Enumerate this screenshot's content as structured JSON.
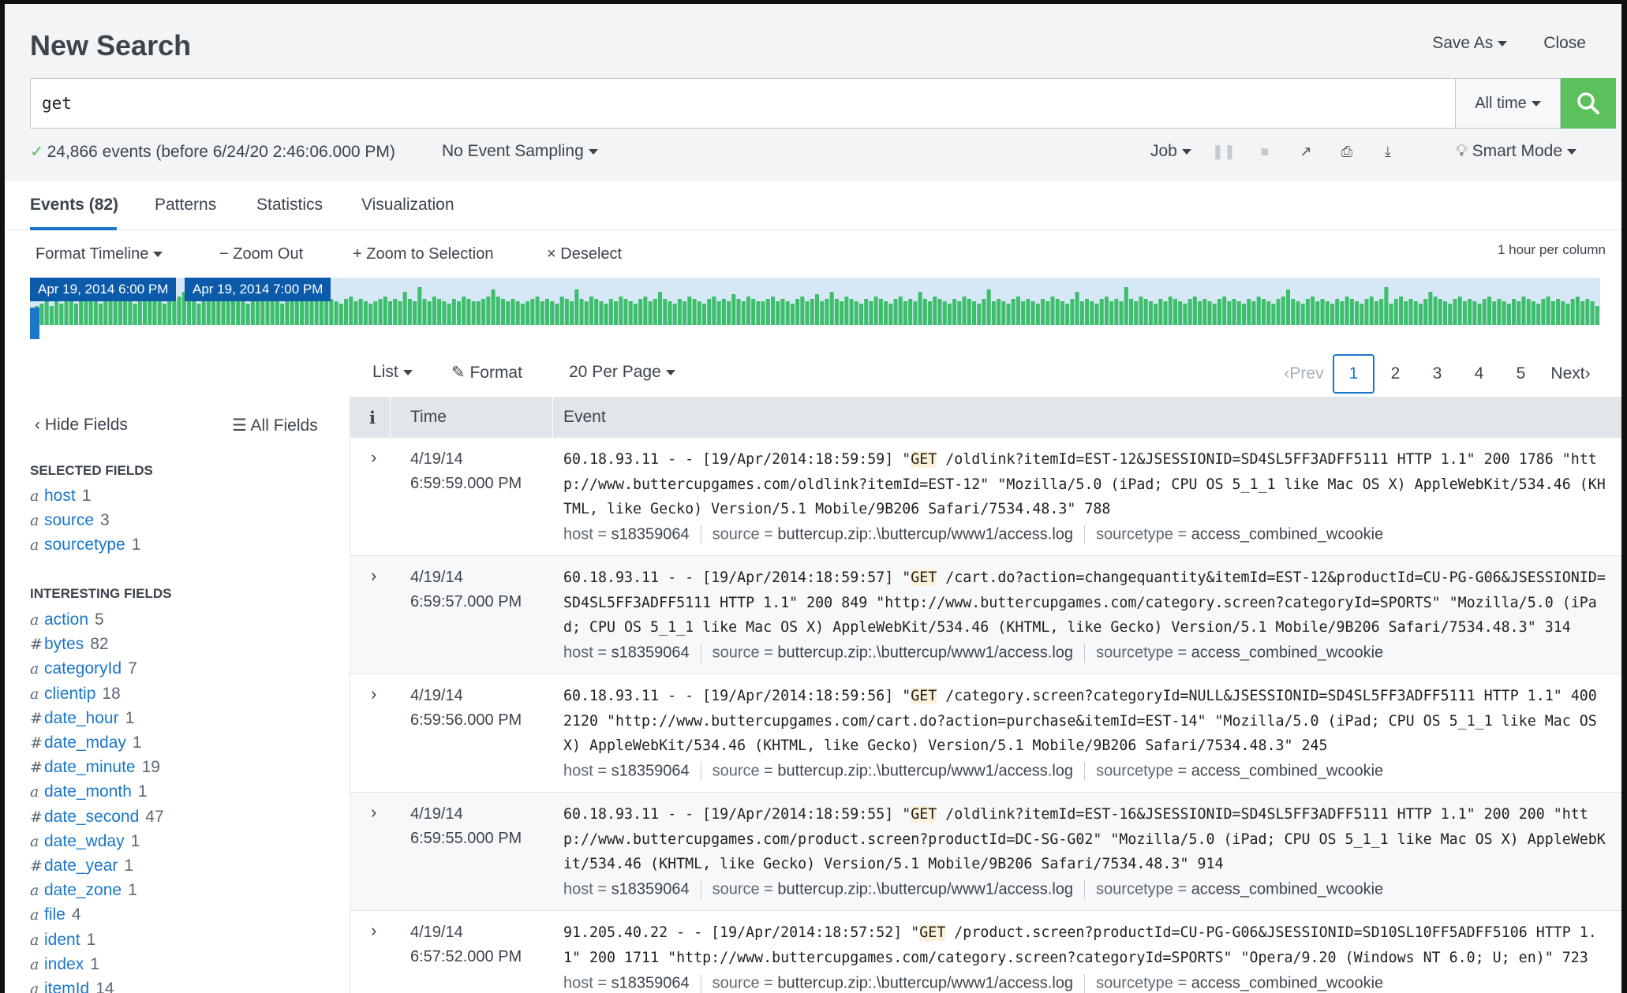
{
  "header": {
    "title": "New Search",
    "save_as": "Save As",
    "close": "Close"
  },
  "search": {
    "query": "get",
    "time_range": "All time"
  },
  "status": {
    "event_count": "24,866 events (before 6/24/20 2:46:06.000 PM)",
    "sampling": "No Event Sampling",
    "job": "Job",
    "mode": "Smart Mode"
  },
  "tabs": [
    "Events (82)",
    "Patterns",
    "Statistics",
    "Visualization"
  ],
  "timeline": {
    "format": "Format Timeline",
    "zoom_out": "Zoom Out",
    "zoom_sel": "Zoom to Selection",
    "deselect": "Deselect",
    "per_column": "1 hour per column",
    "tag1": "Apr 19, 2014 6:00 PM",
    "tag2": "Apr 19, 2014 7:00 PM",
    "bar_levels": [
      0.3,
      0.4,
      0.45,
      0.5,
      0.4,
      0.55,
      0.45,
      0.5,
      0.6,
      0.45,
      0.5,
      0.55,
      0.6,
      0.5,
      0.45,
      0.7,
      0.55,
      0.5,
      0.6,
      0.55,
      0.5,
      0.45,
      0.6,
      0.5,
      0.55,
      0.65,
      0.5,
      0.45,
      0.55,
      0.5,
      0.6,
      0.7,
      0.55,
      0.5,
      0.45,
      0.55,
      0.5,
      0.6,
      0.55,
      0.5,
      0.65,
      0.55,
      0.5,
      0.6,
      0.45,
      0.55,
      0.5,
      0.6,
      0.7,
      0.55,
      0.5,
      0.45,
      0.6,
      0.55,
      0.5,
      0.5,
      0.55,
      0.85,
      0.6,
      0.55,
      0.5,
      0.55,
      0.5,
      0.45,
      0.55,
      0.6,
      0.5,
      0.55,
      0.5,
      0.45,
      0.5,
      0.55,
      0.6,
      0.5,
      0.55,
      0.5,
      0.7,
      0.55,
      0.5,
      0.8,
      0.55,
      0.5,
      0.6,
      0.55,
      0.5,
      0.45,
      0.55,
      0.5,
      0.6,
      0.55,
      0.5,
      0.5,
      0.55,
      0.6,
      0.75,
      0.6,
      0.55,
      0.5,
      0.55,
      0.5,
      0.45,
      0.5,
      0.55,
      0.6,
      0.5,
      0.55,
      0.5,
      0.45,
      0.6,
      0.55,
      0.5,
      0.75,
      0.55,
      0.5,
      0.6,
      0.55,
      0.5,
      0.45,
      0.55,
      0.5,
      0.6,
      0.55,
      0.5,
      0.45,
      0.55,
      0.6,
      0.5,
      0.55,
      0.7,
      0.55,
      0.5,
      0.45,
      0.55,
      0.5,
      0.6,
      0.55,
      0.5,
      0.45,
      0.55,
      0.6,
      0.5,
      0.55,
      0.5,
      0.65,
      0.55,
      0.5,
      0.6,
      0.55,
      0.5,
      0.5,
      0.55,
      0.6,
      0.5,
      0.55,
      0.5,
      0.45,
      0.55,
      0.6,
      0.5,
      0.55,
      0.65,
      0.5,
      0.55,
      0.7,
      0.55,
      0.5,
      0.6,
      0.55,
      0.5,
      0.45,
      0.55,
      0.5,
      0.6,
      0.55,
      0.5,
      0.45,
      0.55,
      0.6,
      0.5,
      0.55,
      0.5,
      0.7,
      0.55,
      0.5,
      0.6,
      0.55,
      0.5,
      0.45,
      0.55,
      0.5,
      0.6,
      0.55,
      0.5,
      0.45,
      0.55,
      0.75,
      0.5,
      0.55,
      0.5,
      0.45,
      0.55,
      0.6,
      0.5,
      0.55,
      0.5,
      0.45,
      0.55,
      0.5,
      0.6,
      0.55,
      0.5,
      0.45,
      0.55,
      0.7,
      0.5,
      0.55,
      0.5,
      0.45,
      0.55,
      0.6,
      0.5,
      0.55,
      0.5,
      0.8,
      0.55,
      0.5,
      0.6,
      0.55,
      0.5,
      0.45,
      0.55,
      0.5,
      0.6,
      0.55,
      0.5,
      0.45,
      0.55,
      0.6,
      0.5,
      0.55,
      0.5,
      0.45,
      0.55,
      0.6,
      0.5,
      0.55,
      0.5,
      0.45,
      0.55,
      0.5,
      0.6,
      0.55,
      0.5,
      0.45,
      0.55,
      0.6,
      0.75,
      0.55,
      0.5,
      0.45,
      0.55,
      0.6,
      0.5,
      0.55,
      0.5,
      0.45,
      0.55,
      0.5,
      0.6,
      0.55,
      0.5,
      0.45,
      0.55,
      0.6,
      0.5,
      0.55,
      0.8,
      0.45,
      0.55,
      0.6,
      0.5,
      0.55,
      0.5,
      0.45,
      0.55,
      0.7,
      0.6,
      0.55,
      0.5,
      0.45,
      0.55,
      0.6,
      0.5,
      0.55,
      0.5,
      0.45,
      0.55,
      0.6,
      0.5,
      0.55,
      0.5,
      0.45,
      0.55,
      0.5,
      0.6,
      0.55,
      0.5,
      0.45,
      0.55,
      0.6,
      0.5,
      0.55,
      0.5,
      0.45,
      0.55,
      0.6,
      0.5,
      0.55,
      0.5,
      0.4
    ]
  },
  "results": {
    "view": "List",
    "format": "Format",
    "per_page": "20 Per Page",
    "prev": "Prev",
    "next": "Next",
    "pages": [
      "1",
      "2",
      "3",
      "4",
      "5"
    ]
  },
  "sidebar": {
    "hide_fields": "Hide Fields",
    "all_fields": "All Fields",
    "selected_title": "SELECTED FIELDS",
    "selected": [
      {
        "type": "a",
        "name": "host",
        "count": "1"
      },
      {
        "type": "a",
        "name": "source",
        "count": "3"
      },
      {
        "type": "a",
        "name": "sourcetype",
        "count": "1"
      }
    ],
    "interesting_title": "INTERESTING FIELDS",
    "interesting": [
      {
        "type": "a",
        "name": "action",
        "count": "5"
      },
      {
        "type": "#",
        "name": "bytes",
        "count": "82"
      },
      {
        "type": "a",
        "name": "categoryId",
        "count": "7"
      },
      {
        "type": "a",
        "name": "clientip",
        "count": "18"
      },
      {
        "type": "#",
        "name": "date_hour",
        "count": "1"
      },
      {
        "type": "#",
        "name": "date_mday",
        "count": "1"
      },
      {
        "type": "#",
        "name": "date_minute",
        "count": "19"
      },
      {
        "type": "a",
        "name": "date_month",
        "count": "1"
      },
      {
        "type": "#",
        "name": "date_second",
        "count": "47"
      },
      {
        "type": "a",
        "name": "date_wday",
        "count": "1"
      },
      {
        "type": "#",
        "name": "date_year",
        "count": "1"
      },
      {
        "type": "a",
        "name": "date_zone",
        "count": "1"
      },
      {
        "type": "a",
        "name": "file",
        "count": "4"
      },
      {
        "type": "a",
        "name": "ident",
        "count": "1"
      },
      {
        "type": "a",
        "name": "index",
        "count": "1"
      },
      {
        "type": "a",
        "name": "itemId",
        "count": "14"
      }
    ]
  },
  "events_table": {
    "col_i": "i",
    "col_time": "Time",
    "col_event": "Event",
    "rows": [
      {
        "date": "4/19/14",
        "time": "6:59:59.000 PM",
        "pre": "60.18.93.11 - - [19/Apr/2014:18:59:59] \"",
        "hl": "GET",
        "post": " /oldlink?itemId=EST-12&JSESSIONID=SD4SL5FF3ADFF5111 HTTP 1.1\" 200 1786 \"http://www.buttercupgames.com/oldlink?itemId=EST-12\" \"Mozilla/5.0 (iPad; CPU OS 5_1_1 like Mac OS X) AppleWebKit/534.46 (KHTML, like Gecko) Version/5.1 Mobile/9B206 Safari/7534.48.3\" 788",
        "host": "s18359064",
        "source": "buttercup.zip:.\\buttercup/www1/access.log",
        "sourcetype": "access_combined_wcookie"
      },
      {
        "date": "4/19/14",
        "time": "6:59:57.000 PM",
        "pre": "60.18.93.11 - - [19/Apr/2014:18:59:57] \"",
        "hl": "GET",
        "post": " /cart.do?action=changequantity&itemId=EST-12&productId=CU-PG-G06&JSESSIONID=SD4SL5FF3ADFF5111 HTTP 1.1\" 200 849 \"http://www.buttercupgames.com/category.screen?categoryId=SPORTS\" \"Mozilla/5.0 (iPad; CPU OS 5_1_1 like Mac OS X) AppleWebKit/534.46 (KHTML, like Gecko) Version/5.1 Mobile/9B206 Safari/7534.48.3\" 314",
        "host": "s18359064",
        "source": "buttercup.zip:.\\buttercup/www1/access.log",
        "sourcetype": "access_combined_wcookie"
      },
      {
        "date": "4/19/14",
        "time": "6:59:56.000 PM",
        "pre": "60.18.93.11 - - [19/Apr/2014:18:59:56] \"",
        "hl": "GET",
        "post": " /category.screen?categoryId=NULL&JSESSIONID=SD4SL5FF3ADFF5111 HTTP 1.1\" 400 2120 \"http://www.buttercupgames.com/cart.do?action=purchase&itemId=EST-14\" \"Mozilla/5.0 (iPad; CPU OS 5_1_1 like Mac OS X) AppleWebKit/534.46 (KHTML, like Gecko) Version/5.1 Mobile/9B206 Safari/7534.48.3\" 245",
        "host": "s18359064",
        "source": "buttercup.zip:.\\buttercup/www1/access.log",
        "sourcetype": "access_combined_wcookie"
      },
      {
        "date": "4/19/14",
        "time": "6:59:55.000 PM",
        "pre": "60.18.93.11 - - [19/Apr/2014:18:59:55] \"",
        "hl": "GET",
        "post": " /oldlink?itemId=EST-16&JSESSIONID=SD4SL5FF3ADFF5111 HTTP 1.1\" 200 200 \"http://www.buttercupgames.com/product.screen?productId=DC-SG-G02\" \"Mozilla/5.0 (iPad; CPU OS 5_1_1 like Mac OS X) AppleWebKit/534.46 (KHTML, like Gecko) Version/5.1 Mobile/9B206 Safari/7534.48.3\" 914",
        "host": "s18359064",
        "source": "buttercup.zip:.\\buttercup/www1/access.log",
        "sourcetype": "access_combined_wcookie"
      },
      {
        "date": "4/19/14",
        "time": "6:57:52.000 PM",
        "pre": "91.205.40.22 - - [19/Apr/2014:18:57:52] \"",
        "hl": "GET",
        "post": " /product.screen?productId=CU-PG-G06&JSESSIONID=SD10SL10FF5ADFF5106 HTTP 1.1\" 200 1711 \"http://www.buttercupgames.com/category.screen?categoryId=SPORTS\" \"Opera/9.20 (Windows NT 6.0; U; en)\" 723",
        "host": "s18359064",
        "source": "buttercup.zip:.\\buttercup/www1/access.log",
        "sourcetype": "access_combined_wcookie"
      }
    ]
  },
  "colors": {
    "accent": "#1a77c9",
    "search_button": "#5cc05c",
    "histogram_bar": "#3dbe6b"
  }
}
